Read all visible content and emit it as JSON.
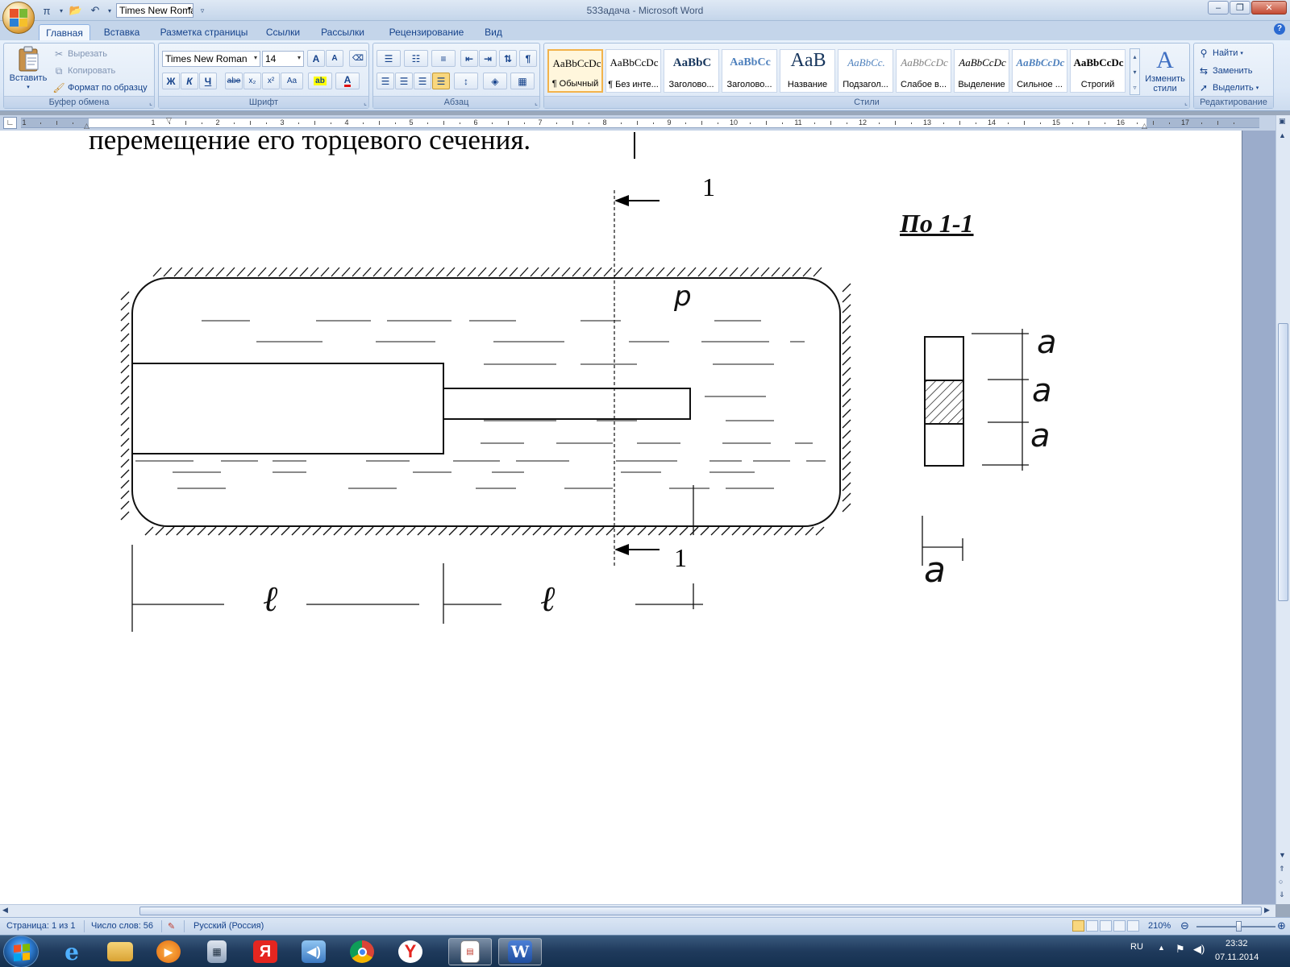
{
  "window": {
    "title": "53Задача - Microsoft Word",
    "qat_font": "Times New Roman"
  },
  "tabs": [
    "Главная",
    "Вставка",
    "Разметка страницы",
    "Ссылки",
    "Рассылки",
    "Рецензирование",
    "Вид"
  ],
  "ribbon": {
    "clipboard": {
      "paste": "Вставить",
      "cut": "Вырезать",
      "copy": "Копировать",
      "format_painter": "Формат по образцу",
      "label": "Буфер обмена"
    },
    "font": {
      "name": "Times New Roman",
      "size": "14",
      "label": "Шрифт",
      "bold": "Ж",
      "italic": "К",
      "underline": "Ч",
      "strike": "abe",
      "subscript": "x₂",
      "superscript": "x²",
      "case": "Aa",
      "grow": "A",
      "shrink": "A",
      "color_letter": "A"
    },
    "paragraph": {
      "label": "Абзац"
    },
    "styles": {
      "label": "Стили",
      "items": [
        {
          "sample": "AaBbCcDc",
          "name": "¶ Обычный"
        },
        {
          "sample": "AaBbCcDc",
          "name": "¶ Без инте..."
        },
        {
          "sample": "AaBbC",
          "name": "Заголово..."
        },
        {
          "sample": "AaBbCc",
          "name": "Заголово..."
        },
        {
          "sample": "AaB",
          "name": "Название"
        },
        {
          "sample": "AaBbCc.",
          "name": "Подзагол..."
        },
        {
          "sample": "AaBbCcDc",
          "name": "Слабое в..."
        },
        {
          "sample": "AaBbCcDc",
          "name": "Выделение"
        },
        {
          "sample": "AaBbCcDc",
          "name": "Сильное ..."
        },
        {
          "sample": "AaBbCcDc",
          "name": "Строгий"
        }
      ],
      "change_styles": "Изменить стили"
    },
    "editing": {
      "label": "Редактирование",
      "find": "Найти",
      "replace": "Заменить",
      "select": "Выделить"
    }
  },
  "ruler": {
    "numbers": [
      "1",
      "1",
      "2",
      "3",
      "4",
      "5",
      "6",
      "7",
      "8",
      "9",
      "10",
      "11",
      "12",
      "13",
      "14",
      "15",
      "16",
      "17"
    ]
  },
  "document": {
    "text_line": "перемещение его торцевого сечения.",
    "drawing": {
      "section_mark_top": "1",
      "section_mark_bottom": "1",
      "section_title": "По 1-1",
      "pressure_label": "p",
      "length_left": "ℓ",
      "length_right": "ℓ",
      "dim_a_1": "a",
      "dim_a_2": "a",
      "dim_a_3": "a",
      "dim_a_width": "a"
    }
  },
  "statusbar": {
    "page": "Страница: 1 из 1",
    "words": "Число слов: 56",
    "language": "Русский (Россия)",
    "zoom": "210%",
    "zoom_level_percent": 210
  },
  "taskbar": {
    "lang": "RU",
    "time": "23:32",
    "date": "07.11.2014",
    "apps": [
      "internet-explorer",
      "file-explorer",
      "media-player",
      "calculator",
      "yandex",
      "volume-mixer",
      "chrome",
      "yandex-browser",
      "document-viewer",
      "microsoft-word"
    ]
  },
  "colors": {
    "ribbon_text": "#15428b",
    "accent_selected_style": "#f2b34c",
    "taskbar": "#1f3a5c"
  }
}
